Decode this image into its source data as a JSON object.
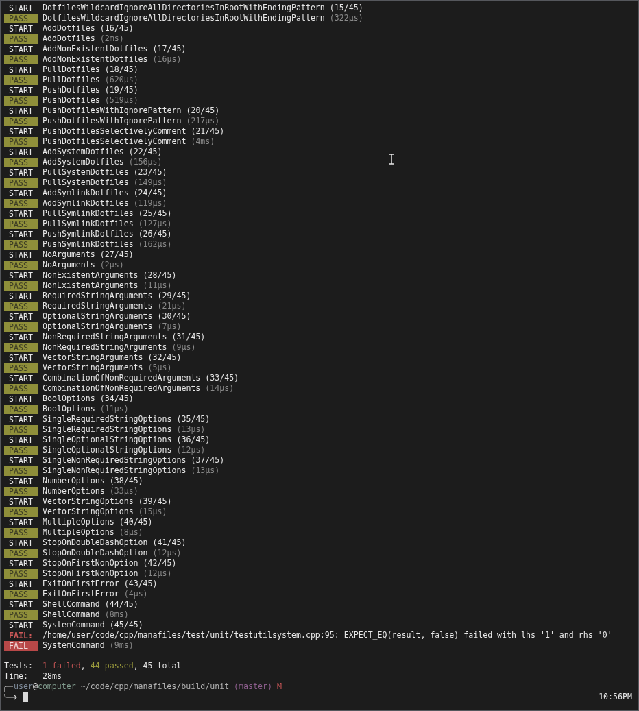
{
  "lines": [
    {
      "kind": "start",
      "tag": "START",
      "name": "DotfilesWildcardIgnoreAllDirectoriesInRootWithEndingPattern",
      "detail": "(15/45)"
    },
    {
      "kind": "pass",
      "tag": "PASS",
      "name": "DotfilesWildcardIgnoreAllDirectoriesInRootWithEndingPattern",
      "detail": "(322µs)"
    },
    {
      "kind": "start",
      "tag": "START",
      "name": "AddDotfiles",
      "detail": "(16/45)"
    },
    {
      "kind": "pass",
      "tag": "PASS",
      "name": "AddDotfiles",
      "detail": "(2ms)"
    },
    {
      "kind": "start",
      "tag": "START",
      "name": "AddNonExistentDotfiles",
      "detail": "(17/45)"
    },
    {
      "kind": "pass",
      "tag": "PASS",
      "name": "AddNonExistentDotfiles",
      "detail": "(16µs)"
    },
    {
      "kind": "start",
      "tag": "START",
      "name": "PullDotfiles",
      "detail": "(18/45)"
    },
    {
      "kind": "pass",
      "tag": "PASS",
      "name": "PullDotfiles",
      "detail": "(620µs)"
    },
    {
      "kind": "start",
      "tag": "START",
      "name": "PushDotfiles",
      "detail": "(19/45)"
    },
    {
      "kind": "pass",
      "tag": "PASS",
      "name": "PushDotfiles",
      "detail": "(519µs)"
    },
    {
      "kind": "start",
      "tag": "START",
      "name": "PushDotfilesWithIgnorePattern",
      "detail": "(20/45)"
    },
    {
      "kind": "pass",
      "tag": "PASS",
      "name": "PushDotfilesWithIgnorePattern",
      "detail": "(217µs)"
    },
    {
      "kind": "start",
      "tag": "START",
      "name": "PushDotfilesSelectivelyComment",
      "detail": "(21/45)"
    },
    {
      "kind": "pass",
      "tag": "PASS",
      "name": "PushDotfilesSelectivelyComment",
      "detail": "(4ms)"
    },
    {
      "kind": "start",
      "tag": "START",
      "name": "AddSystemDotfiles",
      "detail": "(22/45)"
    },
    {
      "kind": "pass",
      "tag": "PASS",
      "name": "AddSystemDotfiles",
      "detail": "(156µs)"
    },
    {
      "kind": "start",
      "tag": "START",
      "name": "PullSystemDotfiles",
      "detail": "(23/45)"
    },
    {
      "kind": "pass",
      "tag": "PASS",
      "name": "PullSystemDotfiles",
      "detail": "(149µs)"
    },
    {
      "kind": "start",
      "tag": "START",
      "name": "AddSymlinkDotfiles",
      "detail": "(24/45)"
    },
    {
      "kind": "pass",
      "tag": "PASS",
      "name": "AddSymlinkDotfiles",
      "detail": "(119µs)"
    },
    {
      "kind": "start",
      "tag": "START",
      "name": "PullSymlinkDotfiles",
      "detail": "(25/45)"
    },
    {
      "kind": "pass",
      "tag": "PASS",
      "name": "PullSymlinkDotfiles",
      "detail": "(127µs)"
    },
    {
      "kind": "start",
      "tag": "START",
      "name": "PushSymlinkDotfiles",
      "detail": "(26/45)"
    },
    {
      "kind": "pass",
      "tag": "PASS",
      "name": "PushSymlinkDotfiles",
      "detail": "(162µs)"
    },
    {
      "kind": "start",
      "tag": "START",
      "name": "NoArguments",
      "detail": "(27/45)"
    },
    {
      "kind": "pass",
      "tag": "PASS",
      "name": "NoArguments",
      "detail": "(2µs)"
    },
    {
      "kind": "start",
      "tag": "START",
      "name": "NonExistentArguments",
      "detail": "(28/45)"
    },
    {
      "kind": "pass",
      "tag": "PASS",
      "name": "NonExistentArguments",
      "detail": "(11µs)"
    },
    {
      "kind": "start",
      "tag": "START",
      "name": "RequiredStringArguments",
      "detail": "(29/45)"
    },
    {
      "kind": "pass",
      "tag": "PASS",
      "name": "RequiredStringArguments",
      "detail": "(21µs)"
    },
    {
      "kind": "start",
      "tag": "START",
      "name": "OptionalStringArguments",
      "detail": "(30/45)"
    },
    {
      "kind": "pass",
      "tag": "PASS",
      "name": "OptionalStringArguments",
      "detail": "(7µs)"
    },
    {
      "kind": "start",
      "tag": "START",
      "name": "NonRequiredStringArguments",
      "detail": "(31/45)"
    },
    {
      "kind": "pass",
      "tag": "PASS",
      "name": "NonRequiredStringArguments",
      "detail": "(9µs)"
    },
    {
      "kind": "start",
      "tag": "START",
      "name": "VectorStringArguments",
      "detail": "(32/45)"
    },
    {
      "kind": "pass",
      "tag": "PASS",
      "name": "VectorStringArguments",
      "detail": "(5µs)"
    },
    {
      "kind": "start",
      "tag": "START",
      "name": "CombinationOfNonRequiredArguments",
      "detail": "(33/45)"
    },
    {
      "kind": "pass",
      "tag": "PASS",
      "name": "CombinationOfNonRequiredArguments",
      "detail": "(14µs)"
    },
    {
      "kind": "start",
      "tag": "START",
      "name": "BoolOptions",
      "detail": "(34/45)"
    },
    {
      "kind": "pass",
      "tag": "PASS",
      "name": "BoolOptions",
      "detail": "(11µs)"
    },
    {
      "kind": "start",
      "tag": "START",
      "name": "SingleRequiredStringOptions",
      "detail": "(35/45)"
    },
    {
      "kind": "pass",
      "tag": "PASS",
      "name": "SingleRequiredStringOptions",
      "detail": "(13µs)"
    },
    {
      "kind": "start",
      "tag": "START",
      "name": "SingleOptionalStringOptions",
      "detail": "(36/45)"
    },
    {
      "kind": "pass",
      "tag": "PASS",
      "name": "SingleOptionalStringOptions",
      "detail": "(12µs)"
    },
    {
      "kind": "start",
      "tag": "START",
      "name": "SingleNonRequiredStringOptions",
      "detail": "(37/45)"
    },
    {
      "kind": "pass",
      "tag": "PASS",
      "name": "SingleNonRequiredStringOptions",
      "detail": "(13µs)"
    },
    {
      "kind": "start",
      "tag": "START",
      "name": "NumberOptions",
      "detail": "(38/45)"
    },
    {
      "kind": "pass",
      "tag": "PASS",
      "name": "NumberOptions",
      "detail": "(33µs)"
    },
    {
      "kind": "start",
      "tag": "START",
      "name": "VectorStringOptions",
      "detail": "(39/45)"
    },
    {
      "kind": "pass",
      "tag": "PASS",
      "name": "VectorStringOptions",
      "detail": "(15µs)"
    },
    {
      "kind": "start",
      "tag": "START",
      "name": "MultipleOptions",
      "detail": "(40/45)"
    },
    {
      "kind": "pass",
      "tag": "PASS",
      "name": "MultipleOptions",
      "detail": "(8µs)"
    },
    {
      "kind": "start",
      "tag": "START",
      "name": "StopOnDoubleDashOption",
      "detail": "(41/45)"
    },
    {
      "kind": "pass",
      "tag": "PASS",
      "name": "StopOnDoubleDashOption",
      "detail": "(12µs)"
    },
    {
      "kind": "start",
      "tag": "START",
      "name": "StopOnFirstNonOption",
      "detail": "(42/45)"
    },
    {
      "kind": "pass",
      "tag": "PASS",
      "name": "StopOnFirstNonOption",
      "detail": "(12µs)"
    },
    {
      "kind": "start",
      "tag": "START",
      "name": "ExitOnFirstError",
      "detail": "(43/45)"
    },
    {
      "kind": "pass",
      "tag": "PASS",
      "name": "ExitOnFirstError",
      "detail": "(4µs)"
    },
    {
      "kind": "start",
      "tag": "START",
      "name": "ShellCommand",
      "detail": "(44/45)"
    },
    {
      "kind": "pass",
      "tag": "PASS",
      "name": "ShellCommand",
      "detail": "(8ms)"
    },
    {
      "kind": "start",
      "tag": "START",
      "name": "SystemCommand",
      "detail": "(45/45)"
    },
    {
      "kind": "error",
      "tag": "FAIL:",
      "name": "/home/user/code/cpp/manafiles/test/unit/testutilsystem.cpp:95: EXPECT_EQ(result, false) failed with lhs='1' and rhs='0'"
    },
    {
      "kind": "fail",
      "tag": "FAIL",
      "name": "SystemCommand",
      "detail": "(9ms)"
    }
  ],
  "summary": [
    {
      "label": "Tests:",
      "parts": [
        {
          "text": "1 failed",
          "color": "#c25454"
        },
        {
          "text": ", "
        },
        {
          "text": "44 passed",
          "color": "#9a9a3c"
        },
        {
          "text": ", 45 total",
          "color": "#e0e0e0"
        }
      ]
    },
    {
      "label": "Time:",
      "parts": [
        {
          "text": "28ms",
          "color": "#e0e0e0"
        }
      ]
    }
  ],
  "prompt": {
    "parts": [
      {
        "text": "user",
        "color": "#7d8a99"
      },
      {
        "text": "@"
      },
      {
        "text": "computer",
        "color": "#7f9a8c"
      },
      {
        "text": " ~/code/cpp/manafiles/build/unit",
        "color": "#b0b0b0"
      },
      {
        "text": " (master)",
        "color": "#8c5e8c"
      },
      {
        "text": " M",
        "color": "#c25454"
      }
    ],
    "clock": "10:56PM"
  }
}
